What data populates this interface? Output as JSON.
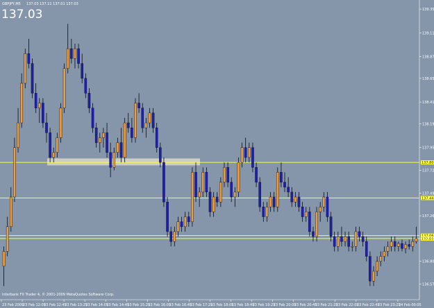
{
  "header": {
    "symbol_line": "GBPJPY,M5",
    "ohlc_line": "137.03 137.11 137.01 137.03",
    "big_price": "137.03"
  },
  "footer": {
    "copyright": "Interbank FX Trader 4, © 2001-2009 MetaQuotes Software Corp."
  },
  "colors": {
    "background": "#8596aa",
    "bull_candle": "#f39c3a",
    "bear_candle": "#1f1fb4",
    "wick": "#0a0a14",
    "level_line": "#ffff33",
    "zone": "#e6e0c8",
    "axis_text": "#ffffff"
  },
  "chart_data": {
    "type": "candlestick",
    "symbol": "GBPJPY",
    "timeframe": "M5",
    "ylim": [
      136.44,
      139.4
    ],
    "y_ticks": [
      "139.35",
      "139.11",
      "138.87",
      "138.65",
      "138.41",
      "138.19",
      "137.95",
      "137.72",
      "137.49",
      "137.26",
      "137.03",
      "136.80",
      "136.57"
    ],
    "x_tick_labels": [
      "23 Feb 2009",
      "23 Feb 12:05",
      "23 Feb 12:45",
      "23 Feb 13:25",
      "23 Feb 14:05",
      "23 Feb 14:45",
      "23 Feb 15:25",
      "23 Feb 16:05",
      "23 Feb 16:45",
      "23 Feb 17:25",
      "23 Feb 18:05",
      "23 Feb 18:45",
      "23 Feb 19:25",
      "23 Feb 20:05",
      "23 Feb 20:45",
      "23 Feb 21:25",
      "23 Feb 22:05",
      "23 Feb 22:45",
      "23 Feb 23:25",
      "24 Feb 00:05"
    ],
    "levels": [
      {
        "value": 137.8,
        "label": "137.80"
      },
      {
        "value": 137.44,
        "label": "137.44"
      },
      {
        "value": 137.06,
        "label": "137.06"
      },
      {
        "value": 137.03,
        "label": "137.03"
      }
    ],
    "support_zone": {
      "low": 137.77,
      "high": 137.84
    },
    "candles": [
      {
        "o": 136.75,
        "h": 136.95,
        "l": 136.55,
        "c": 136.9
      },
      {
        "o": 136.9,
        "h": 137.25,
        "l": 136.85,
        "c": 137.15
      },
      {
        "o": 137.15,
        "h": 137.55,
        "l": 137.1,
        "c": 137.45
      },
      {
        "o": 137.45,
        "h": 138.05,
        "l": 137.4,
        "c": 137.95
      },
      {
        "o": 137.95,
        "h": 138.35,
        "l": 137.9,
        "c": 138.2
      },
      {
        "o": 138.2,
        "h": 138.7,
        "l": 138.15,
        "c": 138.6
      },
      {
        "o": 138.6,
        "h": 138.95,
        "l": 138.55,
        "c": 138.9
      },
      {
        "o": 138.9,
        "h": 139.05,
        "l": 138.75,
        "c": 138.8
      },
      {
        "o": 138.8,
        "h": 138.85,
        "l": 138.45,
        "c": 138.5
      },
      {
        "o": 138.5,
        "h": 138.6,
        "l": 138.3,
        "c": 138.35
      },
      {
        "o": 138.35,
        "h": 138.45,
        "l": 138.2,
        "c": 138.4
      },
      {
        "o": 138.4,
        "h": 138.45,
        "l": 138.15,
        "c": 138.2
      },
      {
        "o": 138.2,
        "h": 138.3,
        "l": 138.0,
        "c": 138.1
      },
      {
        "o": 138.1,
        "h": 138.15,
        "l": 137.8,
        "c": 137.85
      },
      {
        "o": 137.85,
        "h": 137.95,
        "l": 137.8,
        "c": 137.9
      },
      {
        "o": 137.9,
        "h": 138.1,
        "l": 137.85,
        "c": 138.05
      },
      {
        "o": 138.05,
        "h": 138.4,
        "l": 138.0,
        "c": 138.35
      },
      {
        "o": 138.35,
        "h": 138.8,
        "l": 138.3,
        "c": 138.75
      },
      {
        "o": 138.75,
        "h": 139.2,
        "l": 138.7,
        "c": 138.95
      },
      {
        "o": 138.95,
        "h": 139.05,
        "l": 138.8,
        "c": 138.85
      },
      {
        "o": 138.85,
        "h": 139.0,
        "l": 138.75,
        "c": 138.95
      },
      {
        "o": 138.95,
        "h": 139.0,
        "l": 138.75,
        "c": 138.8
      },
      {
        "o": 138.8,
        "h": 138.9,
        "l": 138.6,
        "c": 138.65
      },
      {
        "o": 138.65,
        "h": 138.7,
        "l": 138.45,
        "c": 138.5
      },
      {
        "o": 138.5,
        "h": 138.55,
        "l": 138.3,
        "c": 138.35
      },
      {
        "o": 138.35,
        "h": 138.4,
        "l": 138.1,
        "c": 138.15
      },
      {
        "o": 138.15,
        "h": 138.2,
        "l": 137.95,
        "c": 138.0
      },
      {
        "o": 138.0,
        "h": 138.1,
        "l": 137.9,
        "c": 138.05
      },
      {
        "o": 138.05,
        "h": 138.15,
        "l": 137.95,
        "c": 138.1
      },
      {
        "o": 138.1,
        "h": 138.2,
        "l": 137.85,
        "c": 137.9
      },
      {
        "o": 137.9,
        "h": 138.0,
        "l": 137.65,
        "c": 137.75
      },
      {
        "o": 137.75,
        "h": 137.95,
        "l": 137.72,
        "c": 137.9
      },
      {
        "o": 137.9,
        "h": 138.05,
        "l": 137.85,
        "c": 138.0
      },
      {
        "o": 138.0,
        "h": 138.15,
        "l": 137.8,
        "c": 137.85
      },
      {
        "o": 137.85,
        "h": 138.25,
        "l": 137.8,
        "c": 138.2
      },
      {
        "o": 138.2,
        "h": 138.3,
        "l": 138.1,
        "c": 138.15
      },
      {
        "o": 138.15,
        "h": 138.25,
        "l": 138.0,
        "c": 138.05
      },
      {
        "o": 138.05,
        "h": 138.45,
        "l": 138.0,
        "c": 138.4
      },
      {
        "o": 138.4,
        "h": 138.5,
        "l": 138.3,
        "c": 138.35
      },
      {
        "o": 138.35,
        "h": 138.4,
        "l": 138.1,
        "c": 138.15
      },
      {
        "o": 138.15,
        "h": 138.25,
        "l": 138.05,
        "c": 138.2
      },
      {
        "o": 138.2,
        "h": 138.35,
        "l": 138.15,
        "c": 138.3
      },
      {
        "o": 138.3,
        "h": 138.35,
        "l": 138.1,
        "c": 138.15
      },
      {
        "o": 138.15,
        "h": 138.2,
        "l": 137.9,
        "c": 137.95
      },
      {
        "o": 137.95,
        "h": 138.0,
        "l": 137.75,
        "c": 137.8
      },
      {
        "o": 137.8,
        "h": 137.85,
        "l": 137.35,
        "c": 137.4
      },
      {
        "o": 137.4,
        "h": 137.45,
        "l": 137.05,
        "c": 137.1
      },
      {
        "o": 137.1,
        "h": 137.15,
        "l": 136.95,
        "c": 137.0
      },
      {
        "o": 137.0,
        "h": 137.15,
        "l": 136.95,
        "c": 137.1
      },
      {
        "o": 137.1,
        "h": 137.25,
        "l": 137.05,
        "c": 137.2
      },
      {
        "o": 137.2,
        "h": 137.25,
        "l": 137.1,
        "c": 137.15
      },
      {
        "o": 137.15,
        "h": 137.3,
        "l": 137.1,
        "c": 137.25
      },
      {
        "o": 137.25,
        "h": 137.3,
        "l": 137.15,
        "c": 137.2
      },
      {
        "o": 137.2,
        "h": 137.75,
        "l": 137.15,
        "c": 137.7
      },
      {
        "o": 137.7,
        "h": 137.8,
        "l": 137.4,
        "c": 137.45
      },
      {
        "o": 137.45,
        "h": 137.55,
        "l": 137.35,
        "c": 137.5
      },
      {
        "o": 137.5,
        "h": 137.75,
        "l": 137.45,
        "c": 137.7
      },
      {
        "o": 137.7,
        "h": 137.75,
        "l": 137.45,
        "c": 137.5
      },
      {
        "o": 137.5,
        "h": 137.55,
        "l": 137.25,
        "c": 137.3
      },
      {
        "o": 137.3,
        "h": 137.5,
        "l": 137.25,
        "c": 137.45
      },
      {
        "o": 137.45,
        "h": 137.5,
        "l": 137.35,
        "c": 137.4
      },
      {
        "o": 137.4,
        "h": 137.65,
        "l": 137.35,
        "c": 137.6
      },
      {
        "o": 137.6,
        "h": 137.8,
        "l": 137.55,
        "c": 137.75
      },
      {
        "o": 137.75,
        "h": 137.8,
        "l": 137.55,
        "c": 137.6
      },
      {
        "o": 137.6,
        "h": 137.65,
        "l": 137.4,
        "c": 137.45
      },
      {
        "o": 137.45,
        "h": 137.55,
        "l": 137.35,
        "c": 137.5
      },
      {
        "o": 137.5,
        "h": 137.85,
        "l": 137.45,
        "c": 137.8
      },
      {
        "o": 137.8,
        "h": 138.0,
        "l": 137.75,
        "c": 137.95
      },
      {
        "o": 137.95,
        "h": 138.05,
        "l": 137.8,
        "c": 137.85
      },
      {
        "o": 137.85,
        "h": 138.0,
        "l": 137.8,
        "c": 137.95
      },
      {
        "o": 137.95,
        "h": 138.0,
        "l": 137.7,
        "c": 137.75
      },
      {
        "o": 137.75,
        "h": 137.8,
        "l": 137.55,
        "c": 137.6
      },
      {
        "o": 137.6,
        "h": 137.65,
        "l": 137.3,
        "c": 137.35
      },
      {
        "o": 137.35,
        "h": 137.4,
        "l": 137.2,
        "c": 137.25
      },
      {
        "o": 137.25,
        "h": 137.4,
        "l": 137.2,
        "c": 137.35
      },
      {
        "o": 137.35,
        "h": 137.5,
        "l": 137.3,
        "c": 137.45
      },
      {
        "o": 137.45,
        "h": 137.5,
        "l": 137.3,
        "c": 137.35
      },
      {
        "o": 137.35,
        "h": 137.75,
        "l": 137.3,
        "c": 137.7
      },
      {
        "o": 137.7,
        "h": 137.8,
        "l": 137.55,
        "c": 137.6
      },
      {
        "o": 137.6,
        "h": 137.7,
        "l": 137.5,
        "c": 137.55
      },
      {
        "o": 137.55,
        "h": 137.65,
        "l": 137.45,
        "c": 137.5
      },
      {
        "o": 137.5,
        "h": 137.55,
        "l": 137.35,
        "c": 137.4
      },
      {
        "o": 137.4,
        "h": 137.5,
        "l": 137.35,
        "c": 137.45
      },
      {
        "o": 137.45,
        "h": 137.5,
        "l": 137.3,
        "c": 137.35
      },
      {
        "o": 137.35,
        "h": 137.4,
        "l": 137.2,
        "c": 137.25
      },
      {
        "o": 137.25,
        "h": 137.35,
        "l": 137.2,
        "c": 137.3
      },
      {
        "o": 137.3,
        "h": 137.35,
        "l": 137.05,
        "c": 137.1
      },
      {
        "o": 137.1,
        "h": 137.15,
        "l": 137.0,
        "c": 137.05
      },
      {
        "o": 137.05,
        "h": 137.35,
        "l": 137.0,
        "c": 137.3
      },
      {
        "o": 137.3,
        "h": 137.4,
        "l": 137.2,
        "c": 137.35
      },
      {
        "o": 137.35,
        "h": 137.5,
        "l": 137.3,
        "c": 137.45
      },
      {
        "o": 137.45,
        "h": 137.5,
        "l": 137.2,
        "c": 137.25
      },
      {
        "o": 137.25,
        "h": 137.3,
        "l": 137.0,
        "c": 137.05
      },
      {
        "o": 137.05,
        "h": 137.1,
        "l": 136.9,
        "c": 136.95
      },
      {
        "o": 136.95,
        "h": 137.1,
        "l": 136.9,
        "c": 137.05
      },
      {
        "o": 137.05,
        "h": 137.15,
        "l": 136.95,
        "c": 137.0
      },
      {
        "o": 137.0,
        "h": 137.1,
        "l": 136.95,
        "c": 137.05
      },
      {
        "o": 137.05,
        "h": 137.1,
        "l": 136.9,
        "c": 136.95
      },
      {
        "o": 136.95,
        "h": 137.0,
        "l": 136.9,
        "c": 136.95
      },
      {
        "o": 136.95,
        "h": 137.15,
        "l": 136.9,
        "c": 137.1
      },
      {
        "o": 137.1,
        "h": 137.15,
        "l": 137.0,
        "c": 137.05
      },
      {
        "o": 137.05,
        "h": 137.1,
        "l": 136.95,
        "c": 137.0
      },
      {
        "o": 137.0,
        "h": 137.05,
        "l": 136.8,
        "c": 136.85
      },
      {
        "o": 136.85,
        "h": 136.9,
        "l": 136.55,
        "c": 136.6
      },
      {
        "o": 136.6,
        "h": 136.75,
        "l": 136.55,
        "c": 136.7
      },
      {
        "o": 136.7,
        "h": 136.85,
        "l": 136.65,
        "c": 136.8
      },
      {
        "o": 136.8,
        "h": 136.9,
        "l": 136.75,
        "c": 136.85
      },
      {
        "o": 136.85,
        "h": 136.95,
        "l": 136.8,
        "c": 136.9
      },
      {
        "o": 136.9,
        "h": 137.0,
        "l": 136.85,
        "c": 136.95
      },
      {
        "o": 136.95,
        "h": 137.05,
        "l": 136.9,
        "c": 137.0
      },
      {
        "o": 137.0,
        "h": 137.05,
        "l": 136.9,
        "c": 136.95
      },
      {
        "o": 136.95,
        "h": 137.0,
        "l": 136.9,
        "c": 136.98
      },
      {
        "o": 136.98,
        "h": 137.02,
        "l": 136.9,
        "c": 136.93
      },
      {
        "o": 136.93,
        "h": 137.0,
        "l": 136.88,
        "c": 136.97
      },
      {
        "o": 136.97,
        "h": 137.02,
        "l": 136.92,
        "c": 136.95
      },
      {
        "o": 136.95,
        "h": 137.05,
        "l": 136.9,
        "c": 137.0
      },
      {
        "o": 137.0,
        "h": 137.15,
        "l": 136.98,
        "c": 137.03
      }
    ]
  }
}
